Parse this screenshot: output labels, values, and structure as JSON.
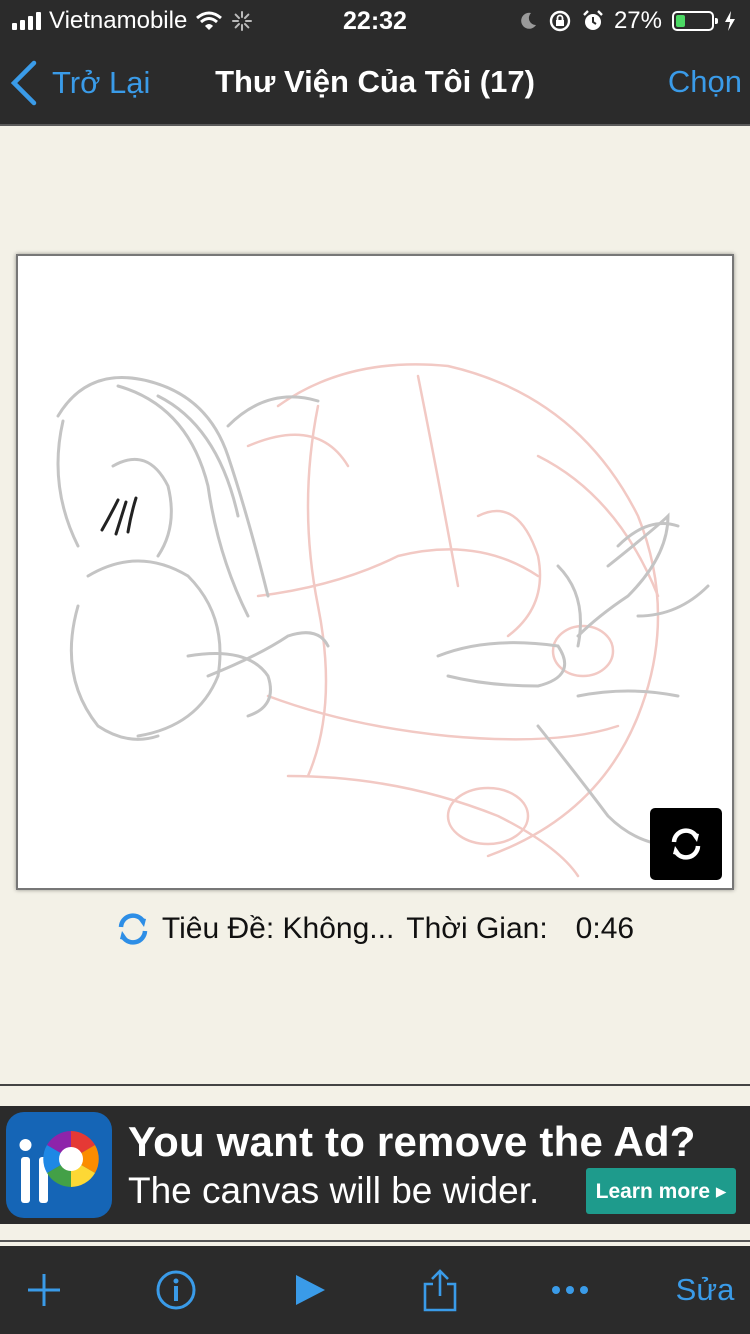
{
  "status_bar": {
    "carrier": "Vietnamobile",
    "time": "22:32",
    "battery_percent": "27%",
    "battery_level": 0.27,
    "icons": [
      "signal-icon",
      "wifi-icon",
      "activity-spinner-icon",
      "moon-icon",
      "rotation-lock-icon",
      "alarm-icon",
      "battery-icon",
      "charging-bolt-icon"
    ]
  },
  "nav": {
    "back_label": "Trở Lại",
    "title": "Thư Viện Của Tôi (17)",
    "select_label": "Chọn"
  },
  "artwork": {
    "title_label": "Tiêu Đề: Không...",
    "time_label": "Thời Gian:",
    "time_value": "0:46"
  },
  "ad": {
    "headline": "You want to remove the Ad?",
    "subline": "The canvas will be wider.",
    "cta": "Learn more ▸"
  },
  "toolbar": {
    "items": [
      "add-icon",
      "info-icon",
      "play-icon",
      "share-icon",
      "more-icon"
    ],
    "edit_label": "Sửa"
  },
  "colors": {
    "bar_background": "#2b2b2b",
    "accent_blue": "#3a9be8",
    "page_background": "#f3f1e7",
    "battery_green": "#4cd964",
    "ad_button": "#1e9b8c"
  }
}
